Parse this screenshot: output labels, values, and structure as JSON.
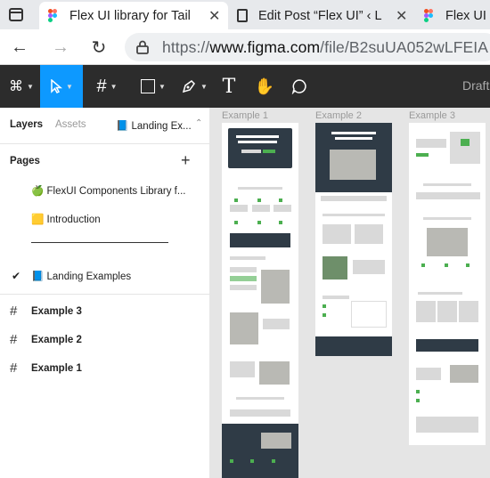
{
  "browser": {
    "tabs": [
      {
        "title": "Flex UI library for Tail",
        "active": true,
        "icon": "figma-icon"
      },
      {
        "title": "Edit Post “Flex UI” ‹ L",
        "active": false,
        "icon": "document-icon"
      },
      {
        "title": "Flex UI",
        "active": false,
        "icon": "figma-icon"
      }
    ],
    "url_prefix": "https://",
    "url_domain": "www.figma.com",
    "url_path": "/file/B2suUA052wLFEIA"
  },
  "toolbar": {
    "draft_label": "Draft"
  },
  "left_panel": {
    "tabs": {
      "layers": "Layers",
      "assets": "Assets",
      "page_selector": "📘 Landing Ex..."
    },
    "pages_header": "Pages",
    "pages": [
      {
        "label": "🍏 FlexUI Components Library f...",
        "checked": false
      },
      {
        "label": "🟨 Introduction",
        "checked": false
      },
      {
        "label": "____________________________",
        "checked": false
      },
      {
        "label": "📘 Landing Examples",
        "checked": true
      }
    ],
    "layers": [
      "Example 3",
      "Example 2",
      "Example 1"
    ]
  },
  "canvas": {
    "frames": [
      "Example 1",
      "Example 2",
      "Example 3"
    ]
  },
  "colors": {
    "accent_blue": "#0d99ff",
    "toolbar_bg": "#2c2c2c",
    "canvas_bg": "#e5e5e5",
    "brand_green": "#4caf50"
  }
}
